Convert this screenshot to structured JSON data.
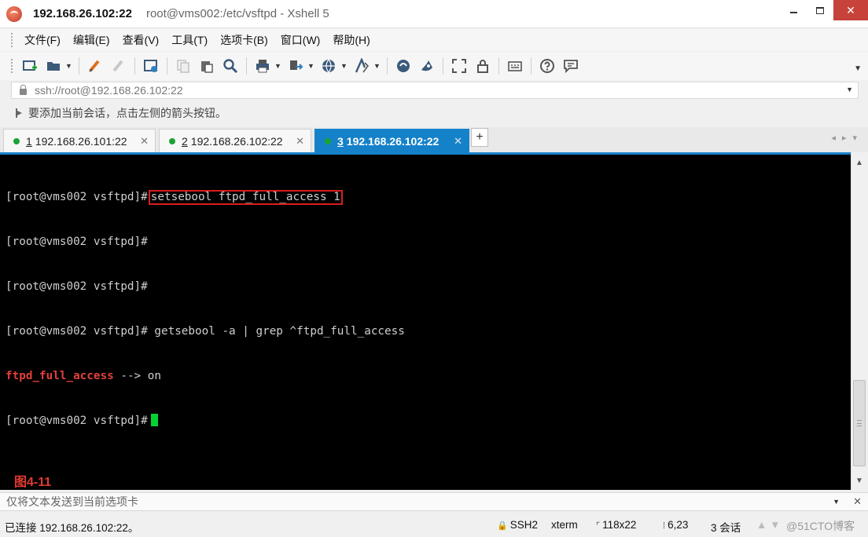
{
  "window": {
    "host_title": "192.168.26.102:22",
    "title_rest": "root@vms002:/etc/vsftpd - Xshell 5",
    "controls": {
      "minimize": "",
      "maximize": "",
      "close": "✕"
    }
  },
  "menu": [
    "文件(F)",
    "编辑(E)",
    "查看(V)",
    "工具(T)",
    "选项卡(B)",
    "窗口(W)",
    "帮助(H)"
  ],
  "address": {
    "value": "ssh://root@192.168.26.102:22"
  },
  "hint": {
    "text": "要添加当前会话，点击左侧的箭头按钮。"
  },
  "tabs": [
    {
      "num": "1",
      "label": "192.168.26.101:22",
      "active": false
    },
    {
      "num": "2",
      "label": "192.168.26.102:22",
      "active": false
    },
    {
      "num": "3",
      "label": "192.168.26.102:22",
      "active": true
    }
  ],
  "tab_add": "+",
  "terminal": {
    "prompt": "[root@vms002 vsftpd]#",
    "line1_cmd": "setsebool ftpd_full_access 1",
    "line4_cmd": "getsebool -a | grep ^ftpd_full_access",
    "result_key": "ftpd_full_access",
    "result_rest": " --> on",
    "figure_label": "图4-11",
    "colors": {
      "background": "#000000",
      "text": "#cfcfcf",
      "highlight_box": "#d81e1e",
      "cursor": "#00d432"
    }
  },
  "compose": {
    "placeholder": "仅将文本发送到当前选项卡"
  },
  "status": {
    "connection": "已连接 192.168.26.102:22。",
    "protocol": "SSH2",
    "term_type": "xterm",
    "size": "118x22",
    "cursor_pos": "6,23",
    "sessions": "3 会话",
    "watermark": "@51CTO博客"
  },
  "accent": "#1581c9"
}
